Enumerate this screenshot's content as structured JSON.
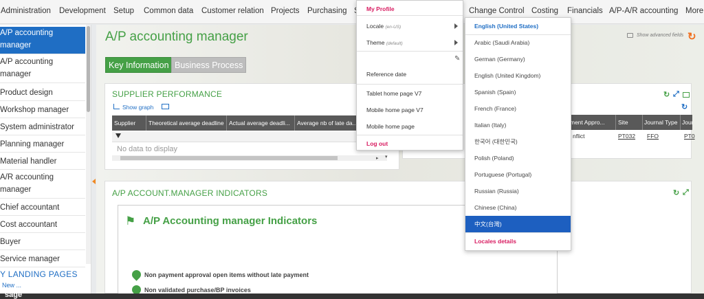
{
  "topnav": {
    "items": [
      "Administration",
      "Development",
      "Setup",
      "Common data",
      "Customer relation",
      "Projects",
      "Purchasing",
      "S",
      "Change Control",
      "Costing",
      "Financials",
      "A/P-A/R accounting",
      "More.."
    ]
  },
  "sidebar": {
    "items": [
      {
        "label_1": "A/P accounting",
        "label_2": "manager"
      },
      {
        "label_1": "A/P accounting",
        "label_2": "manager"
      },
      {
        "label_1": "Product design"
      },
      {
        "label_1": "Workshop manager"
      },
      {
        "label_1": "System administrator"
      },
      {
        "label_1": "Planning manager"
      },
      {
        "label_1": "Material handler"
      },
      {
        "label_1": "A/R accounting",
        "label_2": "manager"
      },
      {
        "label_1": "Chief accountant"
      },
      {
        "label_1": "Cost accountant"
      },
      {
        "label_1": "Buyer"
      },
      {
        "label_1": "Service manager"
      }
    ],
    "landing_pages": "Y LANDING PAGES",
    "new_link": "New ..."
  },
  "main": {
    "title": "A/P accounting manager",
    "show_advanced": "Show advanced fields",
    "tabs": [
      "Key Information",
      "Business Process"
    ]
  },
  "supplier_panel": {
    "title": "SUPPLIER PERFORMANCE",
    "show_graph": "Show graph",
    "columns": [
      "Supplier",
      "Theoretical average deadline",
      "Actual average deadli...",
      "Average nb of late da..."
    ],
    "empty": "No data to display"
  },
  "right_panel": {
    "columns": [
      "ment Appro...",
      "Site",
      "Journal Type",
      "Jour"
    ],
    "row": [
      "nflict",
      "PT032",
      "FFO",
      "PT0"
    ]
  },
  "indicators_panel": {
    "title": "A/P ACCOUNT.MANAGER INDICATORS",
    "heading": "A/P Accounting manager Indicators",
    "items": [
      "Non payment approval open items without late payment",
      "Non validated purchase/BP invoices"
    ]
  },
  "user_menu": {
    "my_profile": "My Profile",
    "locale_label": "Locale",
    "locale_value": "(en-US)",
    "theme_label": "Theme",
    "theme_value": "(default)",
    "reference_date": "Reference date",
    "tablet_home": "Tablet home page V7",
    "mobile_home_v7": "Mobile home page V7",
    "mobile_home": "Mobile home page",
    "logout": "Log out"
  },
  "locale_menu": {
    "items": [
      "English (United States)",
      "Arabic (Saudi Arabia)",
      "German (Germany)",
      "English (United Kingdom)",
      "Spanish (Spain)",
      "French (France)",
      "Italian (Italy)",
      "한국어 (대한민국)",
      "Polish (Poland)",
      "Portuguese (Portugal)",
      "Russian (Russia)",
      "Chinese (China)",
      "中文(台灣)"
    ],
    "selected_index": 12,
    "details": "Locales details"
  },
  "footer": {
    "logo": "sage"
  },
  "colors": {
    "brand_green": "#45a046",
    "selection_blue": "#1d5fc0",
    "accent_pink": "#d81b60",
    "accent_orange": "#f07020"
  }
}
